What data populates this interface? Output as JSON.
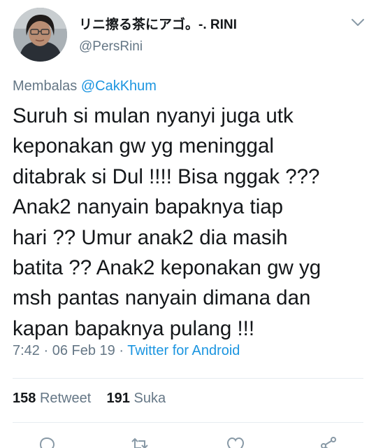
{
  "author": {
    "display_name": "リニ擦る茶にアゴ。-. RINI",
    "handle": "@PersRini",
    "avatar_icon": "profile-photo",
    "menu_icon": "chevron-down-icon"
  },
  "reply": {
    "prefix": "Membalas",
    "mention": "@CakKhum"
  },
  "tweet": {
    "lines": [
      "Suruh si mulan nyanyi juga utk",
      "keponakan gw yg meninggal",
      "ditabrak si Dul !!!! Bisa nggak ???",
      "Anak2 nanyain bapaknya tiap",
      "hari ?? Umur anak2 dia masih",
      "batita ?? Anak2 keponakan gw yg",
      "msh pantas nanyain dimana dan",
      "kapan bapaknya pulang !!!"
    ]
  },
  "meta": {
    "time": "7:42",
    "separator": "·",
    "date": "06 Feb 19",
    "source": "Twitter for Android"
  },
  "stats": {
    "retweet_count": "158",
    "retweet_label": "Retweet",
    "like_count": "191",
    "like_label": "Suka"
  },
  "actions": [
    "reply-icon",
    "retweet-icon",
    "like-icon",
    "share-icon"
  ],
  "colors": {
    "link": "#1b95e0",
    "secondary_text": "#657786",
    "primary_text": "#14171a",
    "divider": "#e6ecf0"
  }
}
